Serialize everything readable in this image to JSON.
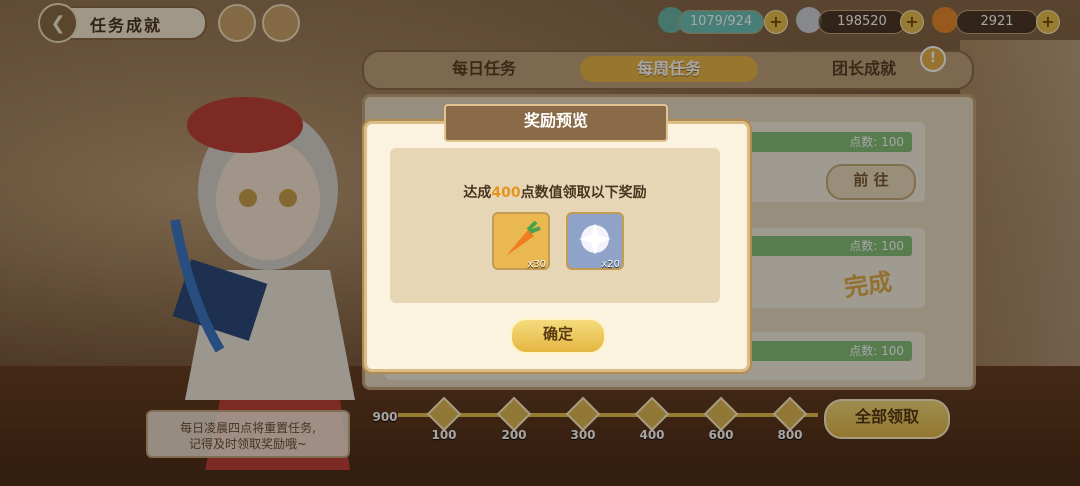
{
  "header": {
    "title": "任务成就",
    "back_icon": "back-icon"
  },
  "resources": [
    {
      "name": "stamina",
      "value": "1079/924",
      "color": "#8ed3c9"
    },
    {
      "name": "gems",
      "value": "198520",
      "color": "#cfd3d8"
    },
    {
      "name": "carrots",
      "value": "2921",
      "color": "#e98a2b"
    }
  ],
  "tabs": [
    {
      "label": "每日任务",
      "active": false
    },
    {
      "label": "每周任务",
      "active": true
    },
    {
      "label": "团长成就",
      "active": false
    }
  ],
  "tab_badge": "!",
  "tasks": [
    {
      "points": "点数: 100",
      "action": "前 往"
    },
    {
      "points": "点数: 100",
      "status": "完成"
    },
    {
      "points": "点数: 100"
    }
  ],
  "progress": {
    "current": "900",
    "milestones": [
      "100",
      "200",
      "300",
      "400",
      "600",
      "800"
    ]
  },
  "claim_all": "全部领取",
  "hint": {
    "line1": "每日凌晨四点将重置任务,",
    "line2": "记得及时领取奖励哦~"
  },
  "modal": {
    "title": "奖励预览",
    "msg_prefix": "达成",
    "msg_highlight": "400",
    "msg_suffix": "点数值领取以下奖励",
    "rewards": [
      {
        "name": "carrot-reward",
        "count": "x30"
      },
      {
        "name": "crystal-reward",
        "count": "x20"
      }
    ],
    "confirm": "确定"
  }
}
